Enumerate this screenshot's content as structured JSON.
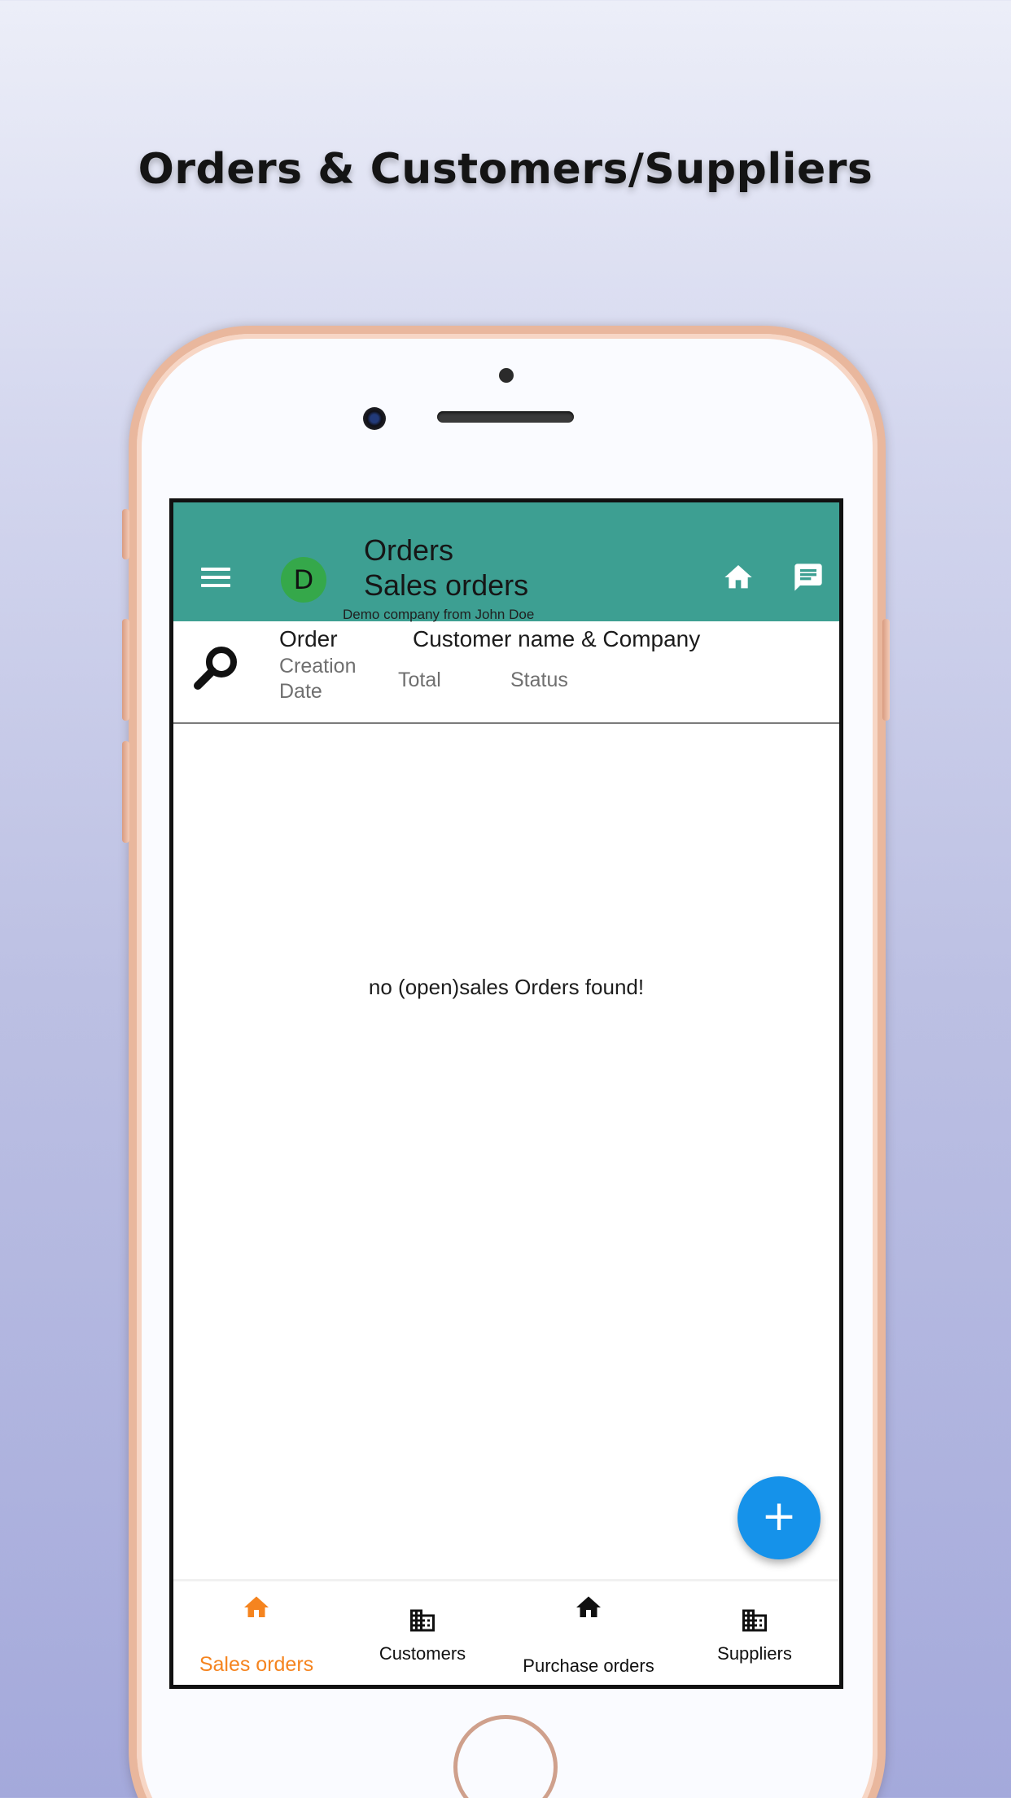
{
  "headline": "Orders & Customers/Suppliers",
  "app_bar": {
    "menu_icon": "menu-icon",
    "avatar_letter": "D",
    "title": "Orders",
    "subtitle": "Sales orders",
    "company": "Demo company from John Doe",
    "actions": [
      "home-icon",
      "chat-icon"
    ]
  },
  "list_header": {
    "search_icon": "search-icon",
    "order": "Order",
    "creation_date": "Creation Date",
    "customer": "Customer name & Company",
    "total": "Total",
    "status": "Status"
  },
  "empty_message": "no (open)sales Orders found!",
  "fab_label": "+",
  "bottom_nav": [
    {
      "label": "Sales orders",
      "icon": "home-icon",
      "active": true
    },
    {
      "label": "Customers",
      "icon": "business-icon",
      "active": false
    },
    {
      "label": "Purchase orders",
      "icon": "home-icon",
      "active": false
    },
    {
      "label": "Suppliers",
      "icon": "business-icon",
      "active": false
    }
  ],
  "colors": {
    "app_bar": "#3d9f92",
    "avatar": "#35a84a",
    "fab": "#1592ea",
    "active_nav": "#f5841f",
    "phone_frame": "#e9b79d"
  }
}
